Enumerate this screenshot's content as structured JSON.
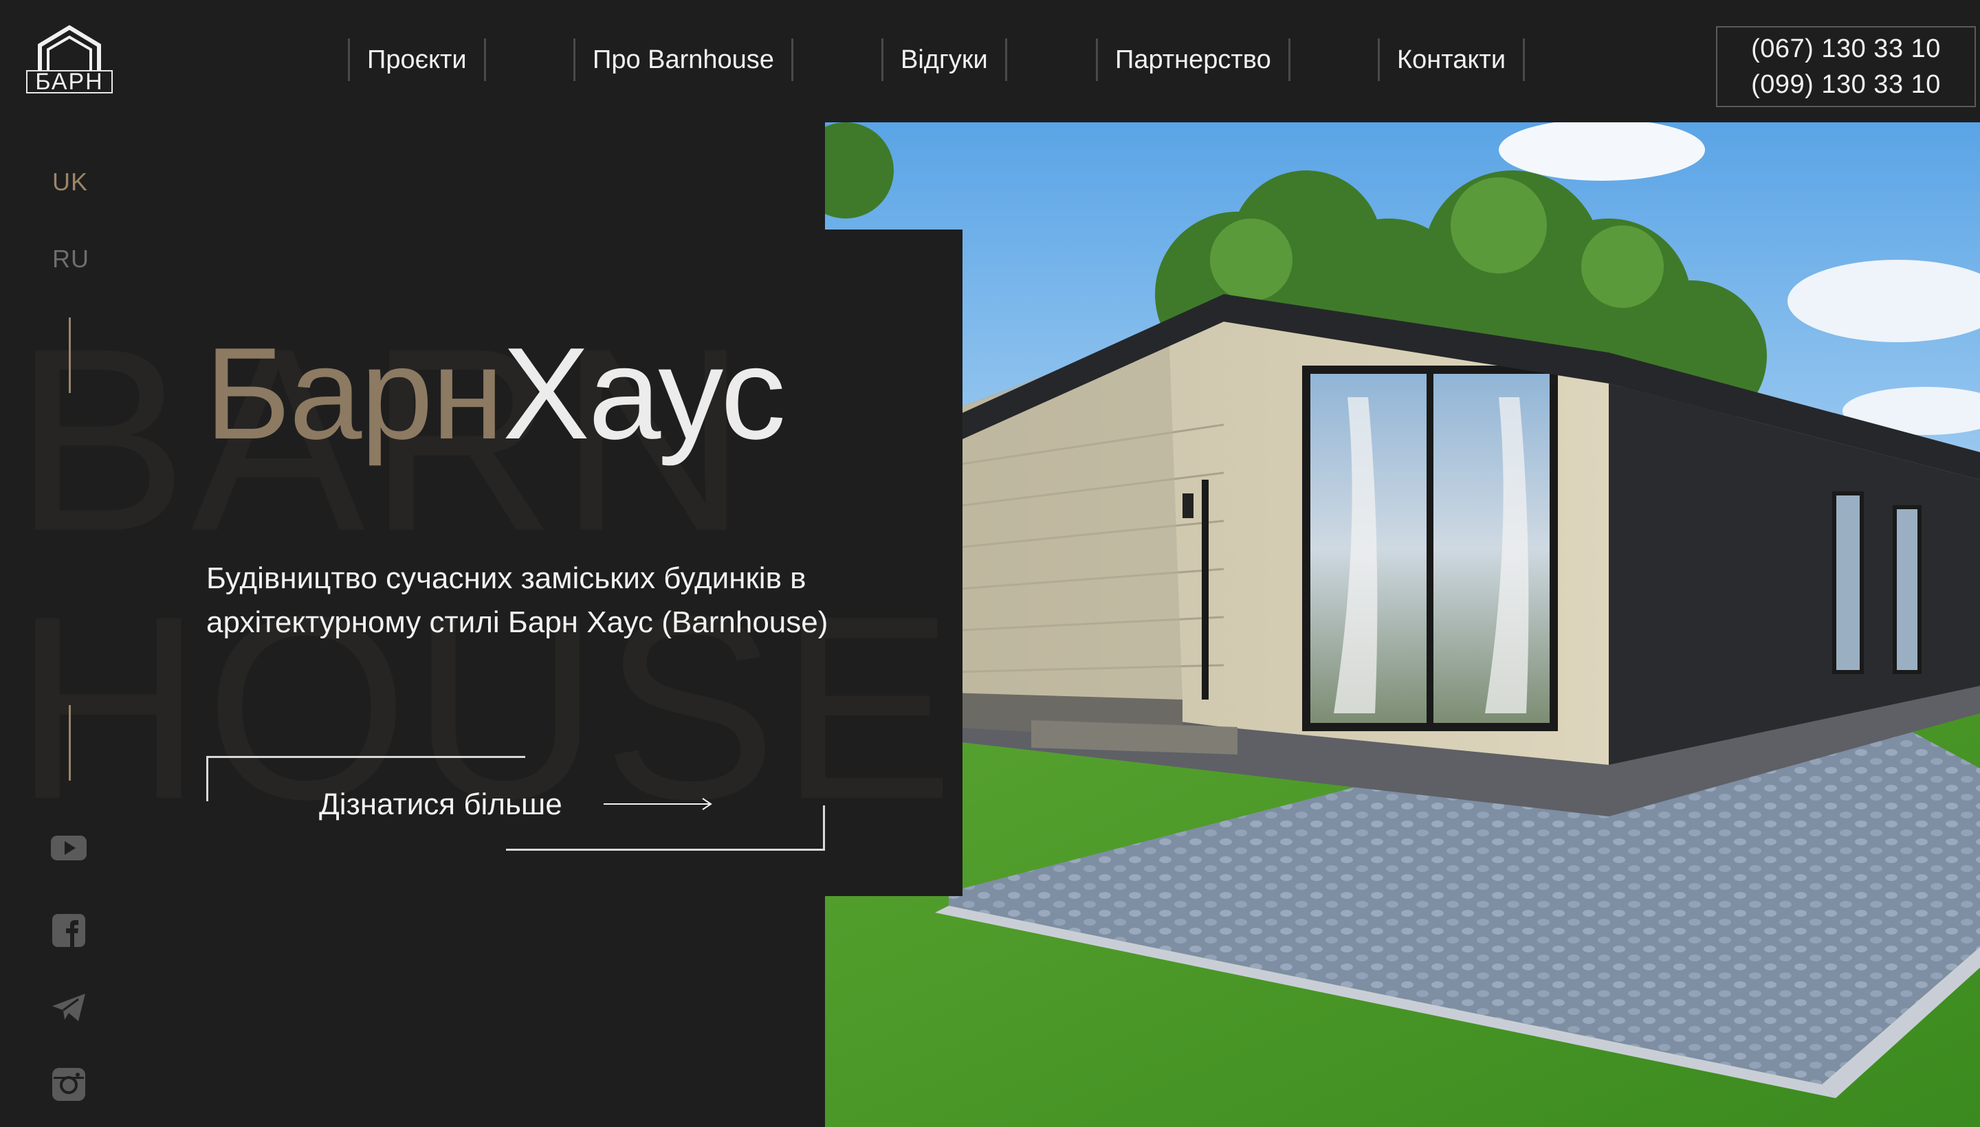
{
  "header": {
    "logo_text": "БАРН",
    "nav": [
      {
        "label": "Проєкти"
      },
      {
        "label": "Про Barnhouse"
      },
      {
        "label": "Відгуки"
      },
      {
        "label": "Партнерство"
      },
      {
        "label": "Контакти"
      }
    ],
    "phones": [
      "(067) 130 33 10",
      "(099) 130 33 10"
    ]
  },
  "languages": {
    "active": "UK",
    "other": "RU"
  },
  "background_text": {
    "line1": "BARN",
    "line2": "HOUSE"
  },
  "hero": {
    "title_part1": "Барн",
    "title_part2": "Хаус",
    "subtitle": "Будівництво сучасних заміських будинків в архітектурному стилі Барн Хаус (Barnhouse)",
    "cta_label": "Дізнатися більше"
  },
  "socials": [
    {
      "icon": "youtube-icon"
    },
    {
      "icon": "facebook-icon"
    },
    {
      "icon": "telegram-icon"
    },
    {
      "icon": "instagram-icon"
    }
  ],
  "colors": {
    "background": "#1e1e1e",
    "accent": "#8d7a62",
    "text": "#f2f2f2"
  }
}
